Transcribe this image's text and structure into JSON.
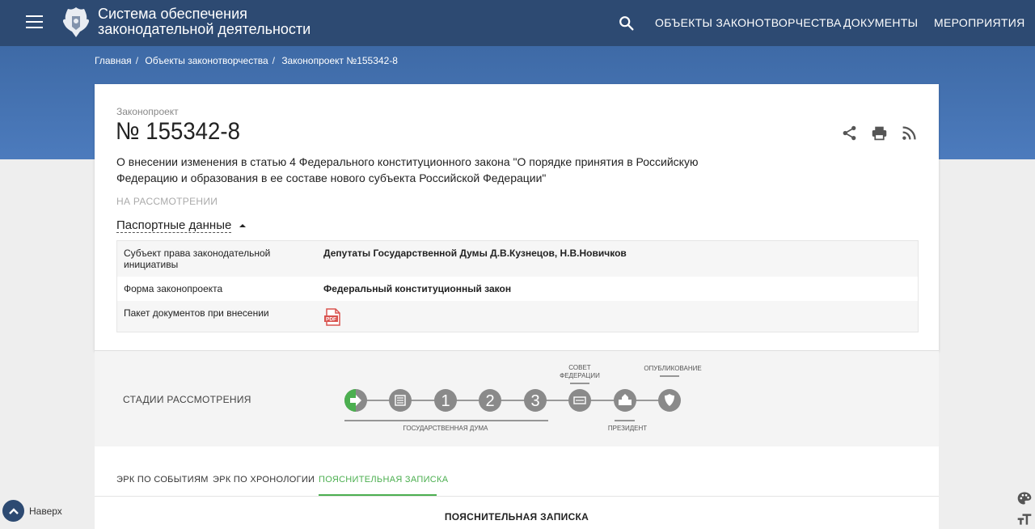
{
  "header": {
    "title_line1": "Система обеспечения",
    "title_line2": "законодательной деятельности",
    "nav": [
      "ОБЪЕКТЫ ЗАКОНОТВОРЧЕСТВА",
      "ДОКУМЕНТЫ",
      "МЕРОПРИЯТИЯ"
    ]
  },
  "breadcrumb": [
    "Главная",
    "Объекты законотворчества",
    "Законопроект №155342-8"
  ],
  "bill": {
    "kind": "Законопроект",
    "number": "№ 155342-8",
    "description": "О внесении изменения в статью 4 Федерального конституционного закона \"О порядке принятия в Российскую Федерацию и образования в ее составе нового субъекта Российской Федерации\"",
    "status": "НА РАССМОТРЕНИИ"
  },
  "passport": {
    "title": "Паспортные данные",
    "rows": [
      {
        "key": "Субъект права законодательной инициативы",
        "value": "Депутаты Государственной Думы Д.В.Кузнецов, Н.В.Новичков"
      },
      {
        "key": "Форма законопроекта",
        "value": "Федеральный конституционный закон"
      },
      {
        "key": "Пакет документов при внесении",
        "value": ""
      }
    ],
    "pdf_label": "PDF"
  },
  "stages": {
    "label": "СТАДИИ РАССМОТРЕНИЯ",
    "digits": [
      "1",
      "2",
      "3"
    ],
    "council": [
      "СОВЕТ",
      "ФЕДЕРАЦИИ"
    ],
    "publication": "ОПУБЛИКОВАНИЕ",
    "duma": "ГОСУДАРСТВЕННАЯ ДУМА",
    "president": "ПРЕЗИДЕНТ",
    "active_stage": 1,
    "colors": {
      "active": "#4caf50",
      "inactive": "#8a8a8a"
    }
  },
  "tabs": [
    "ЭРК ПО СОБЫТИЯМ",
    "ЭРК ПО ХРОНОЛОГИИ",
    "ПОЯСНИТЕЛЬНАЯ ЗАПИСКА"
  ],
  "active_tab": "ПОЯСНИТЕЛЬНАЯ ЗАПИСКА",
  "section_title": "ПОЯСНИТЕЛЬНАЯ ЗАПИСКА",
  "footer": {
    "up_label": "Наверх"
  },
  "icons": [
    "menu-icon",
    "emblem-logo",
    "search-icon",
    "share-icon",
    "print-icon",
    "rss-icon",
    "pdf-icon",
    "chevron-up-icon",
    "palette-icon",
    "font-size-icon"
  ],
  "colors": {
    "header": "#2d4a72",
    "hero": "#4c7bbd",
    "accent": "#4caf50"
  }
}
